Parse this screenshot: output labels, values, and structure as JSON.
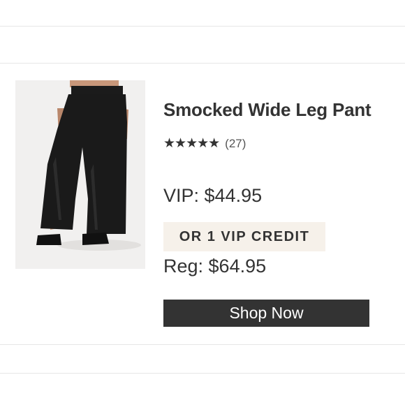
{
  "product": {
    "title": "Smocked Wide Leg Pant",
    "rating": {
      "stars": "★★★★★",
      "value": 5,
      "review_count": "(27)"
    },
    "vip_price": "VIP: $44.95",
    "credit_badge": "OR 1 VIP CREDIT",
    "reg_price": "Reg: $64.95",
    "cta_label": "Shop Now",
    "image_icon": "product-photo-black-wide-leg-pants"
  },
  "colors": {
    "text": "#333333",
    "button_bg": "#333333",
    "button_text": "#ffffff",
    "badge_bg": "#f6f1ea",
    "divider": "#e6e6e6"
  }
}
